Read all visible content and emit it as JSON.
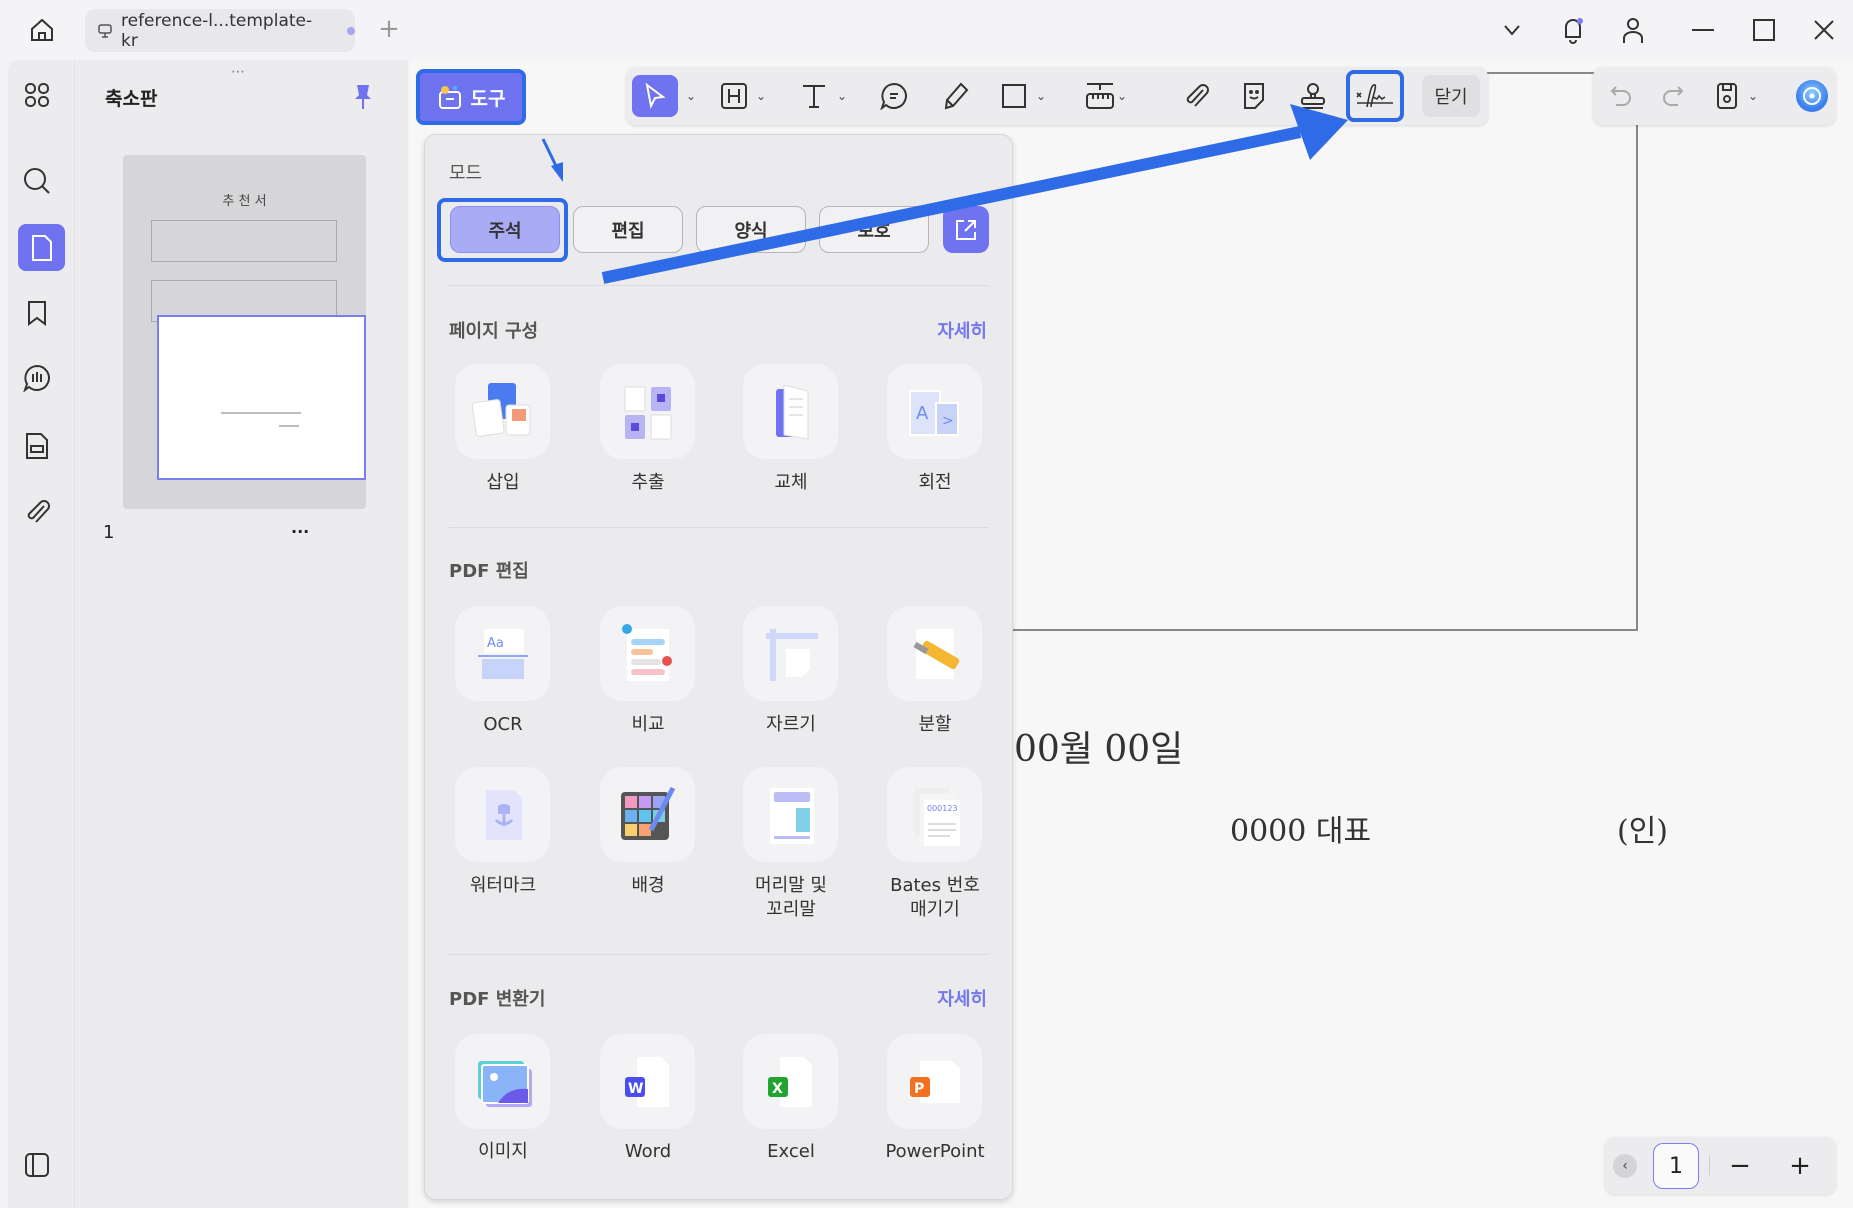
{
  "titlebar": {
    "tab_title": "reference-l...template-kr",
    "icons": [
      "home-icon",
      "monitor-icon",
      "unsaved-dot",
      "plus-icon",
      "chevron-down-icon",
      "bell-icon",
      "user-icon",
      "minimize-icon",
      "maximize-icon",
      "close-icon"
    ]
  },
  "rail": {
    "items": [
      "grid-icon",
      "search-icon",
      "pages-icon",
      "bookmark-icon",
      "comment-icon",
      "form-icon",
      "attachment-icon"
    ],
    "active": "pages-icon",
    "bottom": "sidebar-toggle-icon"
  },
  "thumbnails": {
    "title": "축소판",
    "thumb_heading": "추 천 서",
    "page_number": "1",
    "more": "···"
  },
  "toolbar": {
    "tools_label": "도구",
    "close_label": "닫기",
    "tools": [
      "select-icon",
      "heading-icon",
      "text-icon",
      "comment-icon",
      "pen-icon",
      "rectangle-icon",
      "measure-icon",
      "attachment-icon",
      "sticker-icon",
      "stamp-icon",
      "signature-icon"
    ],
    "highlighted_tool": "signature-icon",
    "right": [
      "undo-icon",
      "redo-icon",
      "save-icon",
      "ai-assistant-icon"
    ]
  },
  "panel": {
    "mode_title": "모드",
    "modes": [
      {
        "label": "주석",
        "active": true
      },
      {
        "label": "편집",
        "active": false
      },
      {
        "label": "양식",
        "active": false
      },
      {
        "label": "보호",
        "active": false
      }
    ],
    "sections": [
      {
        "title": "페이지 구성",
        "more": "자세히",
        "items": [
          "삽입",
          "추출",
          "교체",
          "회전"
        ]
      },
      {
        "title": "PDF 편집",
        "more": "",
        "items": [
          "OCR",
          "비교",
          "자르기",
          "분할",
          "워터마크",
          "배경",
          "머리말 및\n꼬리말",
          "Bates 번호\n매기기"
        ]
      },
      {
        "title": "PDF 변환기",
        "more": "자세히",
        "items": [
          "이미지",
          "Word",
          "Excel",
          "PowerPoint"
        ]
      }
    ]
  },
  "document": {
    "date_line": "00월 00일",
    "rep_line": "0000 대표",
    "seal": "(인)"
  },
  "pagenav": {
    "current_page": "1"
  },
  "colors": {
    "accent": "#6f73f0",
    "highlight": "#2f6be6",
    "link": "#7378ec"
  }
}
